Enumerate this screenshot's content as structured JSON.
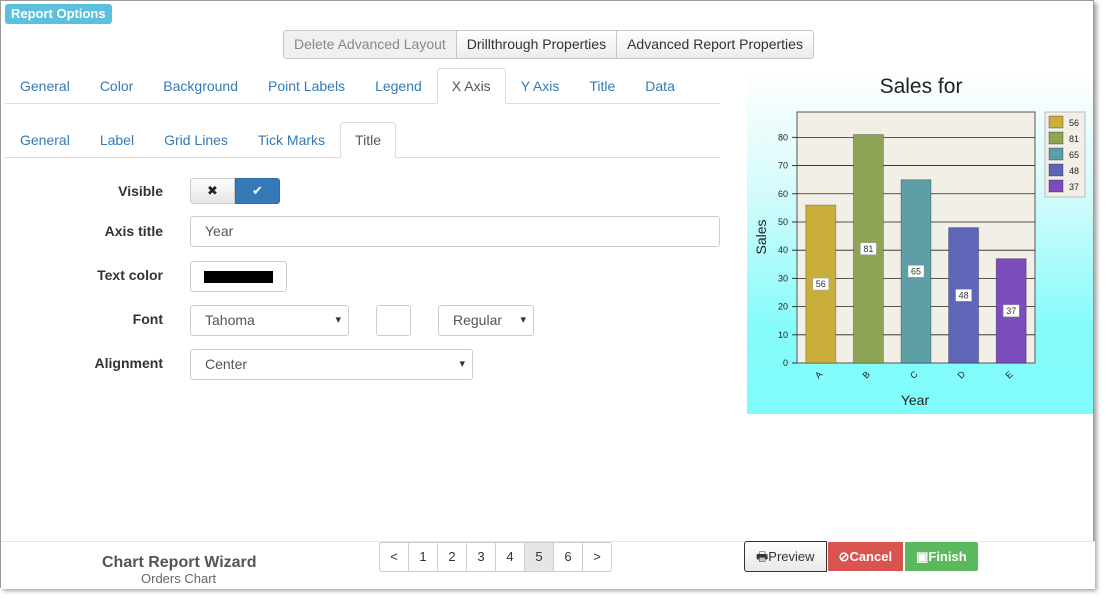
{
  "header": {
    "report_options": "Report Options"
  },
  "top_buttons": {
    "delete_layout": "Delete Advanced Layout",
    "drillthrough": "Drillthrough Properties",
    "advanced_report": "Advanced Report Properties"
  },
  "main_tabs": [
    {
      "label": "General"
    },
    {
      "label": "Color"
    },
    {
      "label": "Background"
    },
    {
      "label": "Point Labels"
    },
    {
      "label": "Legend"
    },
    {
      "label": "X Axis"
    },
    {
      "label": "Y Axis"
    },
    {
      "label": "Title"
    },
    {
      "label": "Data"
    }
  ],
  "main_tabs_active": "X Axis",
  "sub_tabs": [
    {
      "label": "General"
    },
    {
      "label": "Label"
    },
    {
      "label": "Grid Lines"
    },
    {
      "label": "Tick Marks"
    },
    {
      "label": "Title"
    }
  ],
  "sub_tabs_active": "Title",
  "form": {
    "visible_label": "Visible",
    "visible_value": true,
    "axis_title_label": "Axis title",
    "axis_title_value": "Year",
    "text_color_label": "Text color",
    "text_color_value": "#000000",
    "font_label": "Font",
    "font_family_value": "Tahoma",
    "font_size_value": "",
    "font_style_value": "Regular",
    "alignment_label": "Alignment",
    "alignment_value": "Center"
  },
  "chart_data": {
    "type": "bar",
    "title": "Sales for",
    "xlabel": "Year",
    "ylabel": "Sales",
    "categories": [
      "A",
      "B",
      "C",
      "D",
      "E"
    ],
    "values": [
      56,
      81,
      65,
      48,
      37
    ],
    "ylim": [
      0,
      89
    ],
    "yticks": [
      0,
      10,
      20,
      30,
      40,
      50,
      60,
      70,
      80
    ],
    "colors": [
      "#c9ae3c",
      "#8fa454",
      "#5e9ea6",
      "#5f66b8",
      "#7b4cbb"
    ],
    "legend": [
      "56",
      "81",
      "65",
      "48",
      "37"
    ],
    "legend_position": "right",
    "grid": true,
    "background": [
      "#ffffff",
      "#7ffcfc"
    ]
  },
  "footer": {
    "wizard_title": "Chart Report Wizard",
    "wizard_subtitle": "Orders Chart",
    "pager": [
      "<",
      "1",
      "2",
      "3",
      "4",
      "5",
      "6",
      ">"
    ],
    "pager_active": "5",
    "preview": "Preview",
    "cancel": "Cancel",
    "finish": "Finish"
  }
}
